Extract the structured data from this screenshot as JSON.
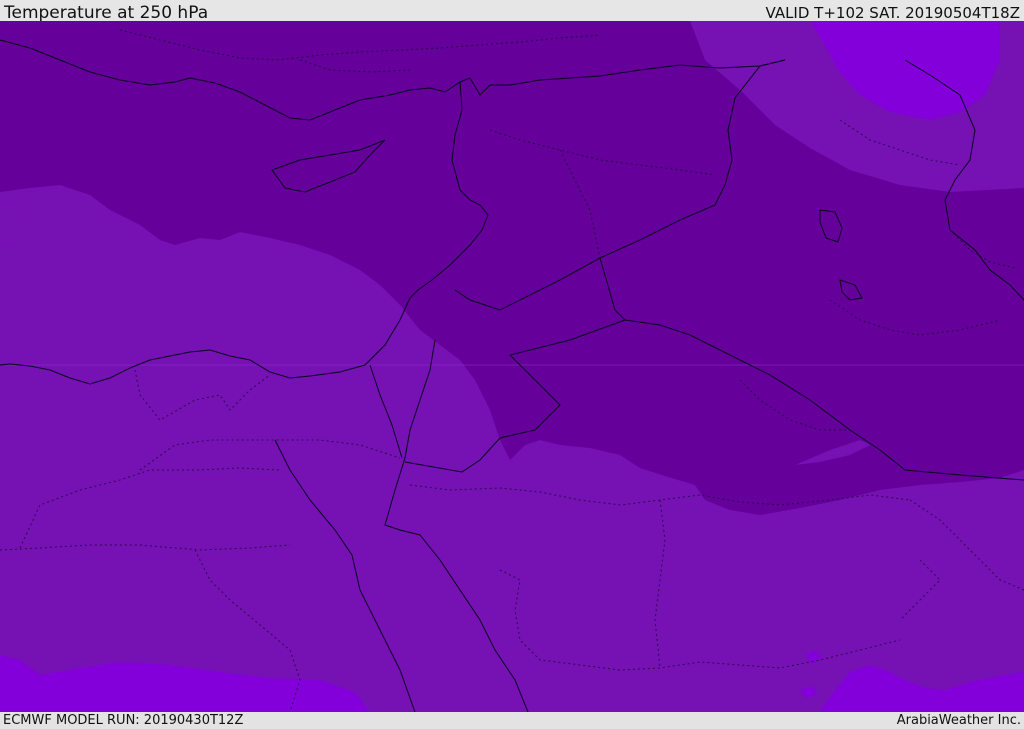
{
  "header": {
    "title": "Temperature at 250 hPa",
    "valid": "VALID T+102 SAT. 20190504T18Z"
  },
  "footer": {
    "model_run": "ECMWF MODEL RUN: 20190430T12Z",
    "credit": "ArabiaWeather Inc."
  },
  "colors": {
    "band_cold": "#65009a",
    "band_mid": "#7611b4",
    "band_warm": "#8300db",
    "coastline": "#0a0620"
  }
}
